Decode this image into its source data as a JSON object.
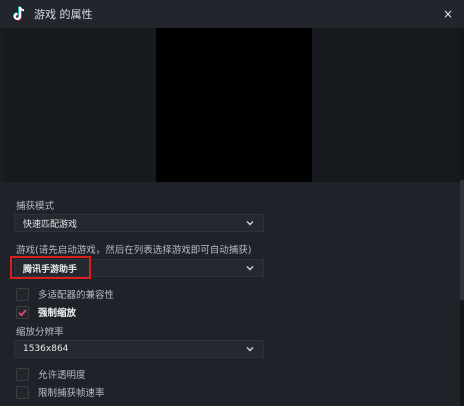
{
  "window": {
    "title": "游戏 的属性",
    "close_glyph": "×"
  },
  "capture_mode": {
    "label": "捕获模式",
    "value": "快速匹配游戏"
  },
  "game": {
    "label": "游戏(请先启动游戏，然后在列表选择游戏即可自动捕获)",
    "value": "腾讯手游助手"
  },
  "options": {
    "multi_adapter": {
      "label": "多适配器的兼容性",
      "checked": false
    },
    "force_scale": {
      "label": "强制缩放",
      "checked": true
    }
  },
  "scale_resolution": {
    "label": "缩放分辨率",
    "value": "1536x864"
  },
  "options2": {
    "allow_transparency": {
      "label": "允许透明度",
      "checked": false
    },
    "limit_capture_rate": {
      "label": "限制捕获帧速率",
      "checked": false
    }
  },
  "colors": {
    "accent_check": "#e8457a",
    "highlight_box": "#d8201c",
    "preview_bg": "#000000"
  }
}
